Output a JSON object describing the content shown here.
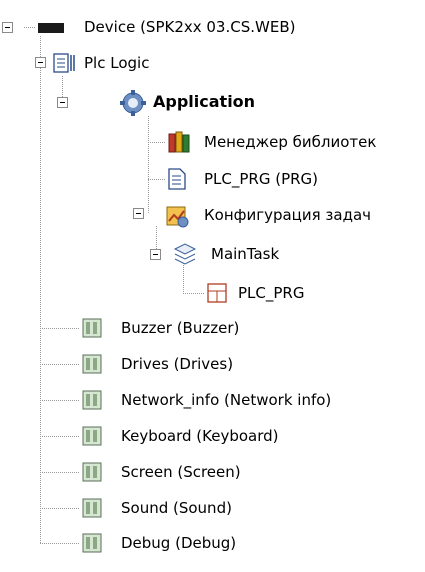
{
  "tree": {
    "device": {
      "label": "Device (SPK2xx 03.CS.WEB)"
    },
    "plc_logic": {
      "label": "Plc Logic"
    },
    "application": {
      "label": "Application"
    },
    "library_manager": {
      "label": "Менеджер библиотек"
    },
    "plc_prg_pou": {
      "label": "PLC_PRG (PRG)"
    },
    "task_config": {
      "label": "Конфигурация задач"
    },
    "main_task": {
      "label": "MainTask"
    },
    "plc_prg_call": {
      "label": "PLC_PRG"
    },
    "devices": [
      {
        "label": "Buzzer (Buzzer)"
      },
      {
        "label": "Drives (Drives)"
      },
      {
        "label": "Network_info (Network info)"
      },
      {
        "label": "Keyboard (Keyboard)"
      },
      {
        "label": "Screen (Screen)"
      },
      {
        "label": "Sound (Sound)"
      },
      {
        "label": "Debug (Debug)"
      }
    ]
  }
}
